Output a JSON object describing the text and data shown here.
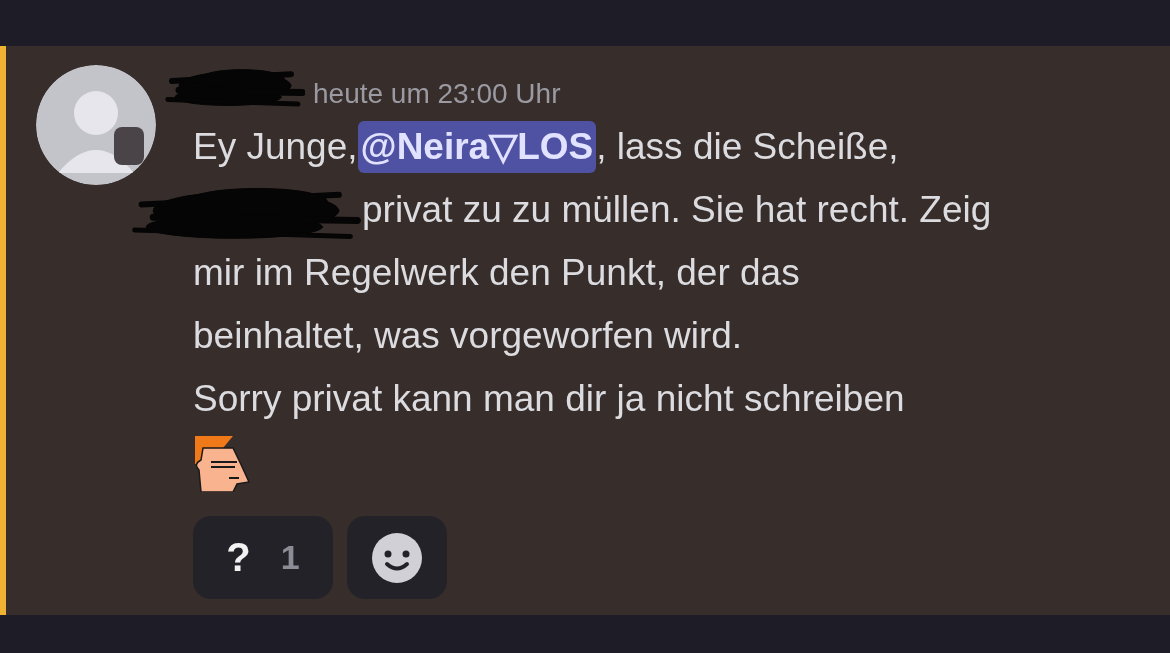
{
  "message": {
    "header": [
      {
        "kind": "redaction"
      },
      {
        "kind": "timestamp",
        "text": "heute um 23:00 Uhr"
      }
    ],
    "lines": [
      {
        "segments": [
          {
            "kind": "text",
            "text": "Ey Junge, "
          },
          {
            "kind": "mention",
            "text": "@Neira▽LOS"
          },
          {
            "kind": "text",
            "text": ", lass die Scheiße,"
          }
        ]
      },
      {
        "segments": [
          {
            "kind": "redaction"
          },
          {
            "kind": "text",
            "text": "privat zu zu müllen. Sie hat recht. Zeig"
          }
        ]
      },
      {
        "segments": [
          {
            "kind": "text",
            "text": "mir im Regelwerk den Punkt, der das"
          }
        ]
      },
      {
        "segments": [
          {
            "kind": "text",
            "text": "beinhaltet, was vorgeworfen wird."
          }
        ]
      },
      {
        "segments": [
          {
            "kind": "text",
            "text": "Sorry privat kann man dir ja nicht schreiben"
          }
        ]
      }
    ],
    "reactions": [
      {
        "emoji": "?",
        "count": "1",
        "selected": false
      }
    ]
  }
}
